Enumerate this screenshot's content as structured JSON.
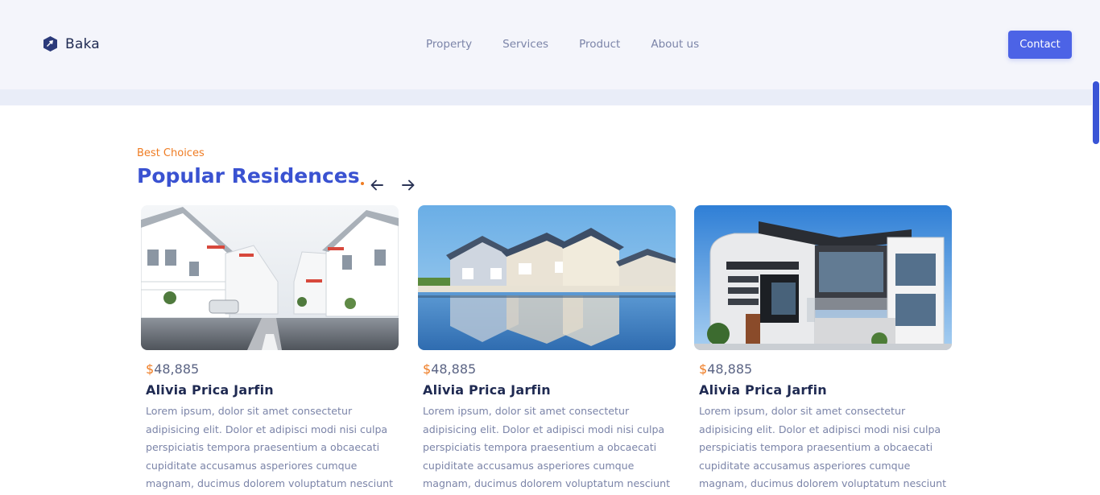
{
  "brand": {
    "name": "Baka",
    "color": "#1f2a52",
    "icon": "baka-logo-icon"
  },
  "nav": {
    "items": [
      {
        "label": "Property"
      },
      {
        "label": "Services"
      },
      {
        "label": "Product"
      },
      {
        "label": "About us"
      }
    ]
  },
  "header": {
    "contact_label": "Contact"
  },
  "section": {
    "eyebrow": "Best Choices",
    "title": "Popular Residences",
    "prev_icon": "arrow-left-icon",
    "next_icon": "arrow-right-icon"
  },
  "cards": [
    {
      "image": "white-villas-street-photo",
      "currency": "$",
      "price": "48,885",
      "title": "Alivia Prica Jarfin",
      "description": "Lorem ipsum, dolor sit amet consectetur adipisicing elit. Dolor et adipisci modi nisi culpa perspiciatis tempora praesentium a obcaecati cupiditate accusamus asperiores cumque magnam, ducimus dolorem voluptatum nesciunt"
    },
    {
      "image": "lakeside-houses-reflection-photo",
      "currency": "$",
      "price": "48,885",
      "title": "Alivia Prica Jarfin",
      "description": "Lorem ipsum, dolor sit amet consectetur adipisicing elit. Dolor et adipisci modi nisi culpa perspiciatis tempora praesentium a obcaecati cupiditate accusamus asperiores cumque magnam, ducimus dolorem voluptatum nesciunt"
    },
    {
      "image": "modern-house-photo",
      "currency": "$",
      "price": "48,885",
      "title": "Alivia Prica Jarfin",
      "description": "Lorem ipsum, dolor sit amet consectetur adipisicing elit. Dolor et adipisci modi nisi culpa perspiciatis tempora praesentium a obcaecati cupiditate accusamus asperiores cumque magnam, ducimus dolorem voluptatum nesciunt"
    }
  ],
  "colors": {
    "accent": "#4c63e6",
    "title_blue": "#3a52d1",
    "orange": "#ef7c23",
    "header_bg": "#f4f5fb",
    "text_muted": "#7b84a8",
    "text_dark": "#1f2a52"
  }
}
